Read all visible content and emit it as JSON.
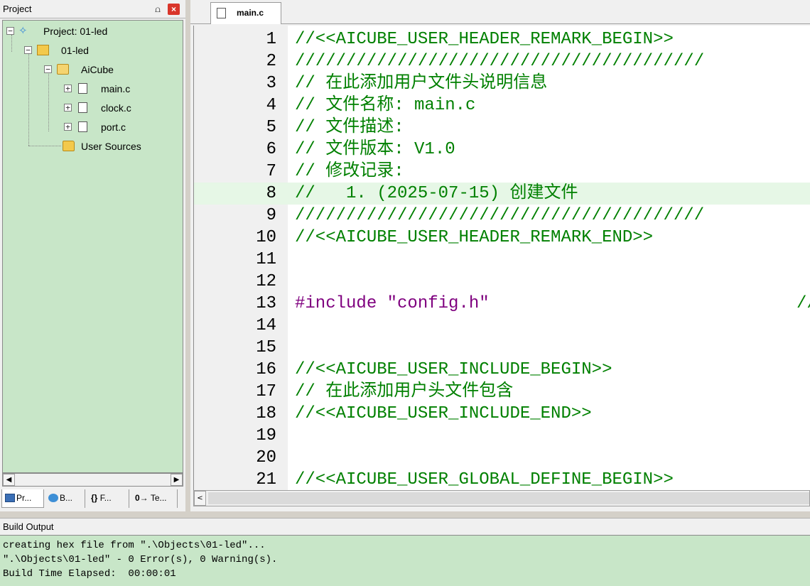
{
  "project_panel": {
    "title": "Project",
    "pin_glyph": "⩍",
    "close_glyph": "×",
    "tree": {
      "root": "Project: 01-led",
      "target": "01-led",
      "group": "AiCube",
      "files": [
        "main.c",
        "clock.c",
        "port.c"
      ],
      "user_group": "User Sources"
    },
    "expander_minus": "−",
    "expander_plus": "+",
    "scroll_left": "◀",
    "scroll_right": "▶",
    "tabs": [
      "Pr...",
      "B...",
      "F...",
      "Te..."
    ],
    "tab_prefixes": [
      "",
      "",
      "{}",
      "0→"
    ]
  },
  "editor": {
    "active_tab": "main.c",
    "current_line": 8,
    "scroll_left": "<",
    "lines": [
      {
        "n": "1",
        "text": "//<<AICUBE_USER_HEADER_REMARK_BEGIN>>",
        "kind": "comment"
      },
      {
        "n": "2",
        "text": "////////////////////////////////////////",
        "kind": "comment"
      },
      {
        "n": "3",
        "text": "// 在此添加用户文件头说明信息",
        "kind": "comment"
      },
      {
        "n": "4",
        "text": "// 文件名称: main.c",
        "kind": "comment"
      },
      {
        "n": "5",
        "text": "// 文件描述:",
        "kind": "comment"
      },
      {
        "n": "6",
        "text": "// 文件版本: V1.0",
        "kind": "comment"
      },
      {
        "n": "7",
        "text": "// 修改记录:",
        "kind": "comment"
      },
      {
        "n": "8",
        "text": "//   1. (2025-07-15) 创建文件",
        "kind": "comment"
      },
      {
        "n": "9",
        "text": "////////////////////////////////////////",
        "kind": "comment"
      },
      {
        "n": "10",
        "text": "//<<AICUBE_USER_HEADER_REMARK_END>>",
        "kind": "comment"
      },
      {
        "n": "11",
        "text": "",
        "kind": "plain"
      },
      {
        "n": "12",
        "text": "",
        "kind": "plain"
      },
      {
        "n": "13",
        "text": "#include \"config.h\"",
        "kind": "include",
        "trailing": "//"
      },
      {
        "n": "14",
        "text": "",
        "kind": "plain"
      },
      {
        "n": "15",
        "text": "",
        "kind": "plain"
      },
      {
        "n": "16",
        "text": "//<<AICUBE_USER_INCLUDE_BEGIN>>",
        "kind": "comment"
      },
      {
        "n": "17",
        "text": "// 在此添加用户头文件包含",
        "kind": "comment"
      },
      {
        "n": "18",
        "text": "//<<AICUBE_USER_INCLUDE_END>>",
        "kind": "comment"
      },
      {
        "n": "19",
        "text": "",
        "kind": "plain"
      },
      {
        "n": "20",
        "text": "",
        "kind": "plain"
      },
      {
        "n": "21",
        "text": "//<<AICUBE_USER_GLOBAL_DEFINE_BEGIN>>",
        "kind": "comment"
      }
    ]
  },
  "build_output": {
    "title": "Build Output",
    "lines": [
      "creating hex file from \".\\Objects\\01-led\"...",
      "\".\\Objects\\01-led\" - 0 Error(s), 0 Warning(s).",
      "Build Time Elapsed:  00:00:01"
    ]
  },
  "colors": {
    "panel_green": "#c8e6c8",
    "comment": "#008000",
    "directive": "#7f007f",
    "current_line": "#e6f7e6"
  }
}
